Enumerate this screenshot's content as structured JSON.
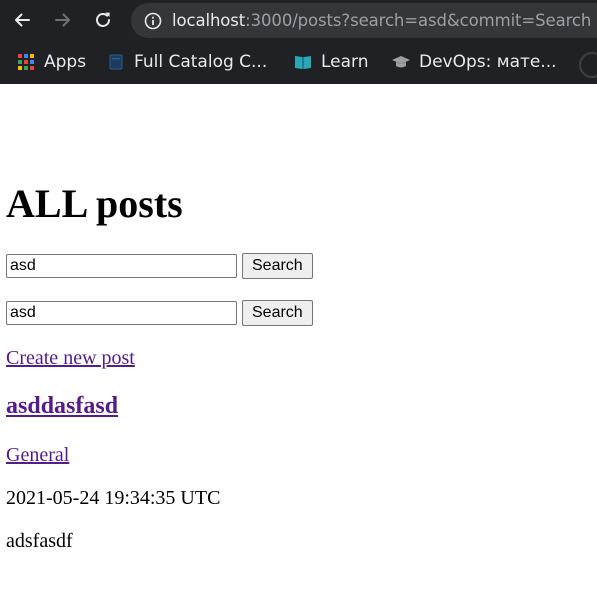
{
  "browser": {
    "url_host": "localhost",
    "url_rest": ":3000/posts?search=asd&commit=Search",
    "bookmarks": [
      {
        "label": "Apps",
        "icon": "apps-grid-icon"
      },
      {
        "label": "Full Catalog C...",
        "icon": "catalog-icon"
      },
      {
        "label": "Learn",
        "icon": "book-icon"
      },
      {
        "label": "DevOps: мате...",
        "icon": "graduation-cap-icon"
      }
    ]
  },
  "page": {
    "title": "ALL posts",
    "search_forms": [
      {
        "value": "asd",
        "button": "Search"
      },
      {
        "value": "asd",
        "button": "Search"
      }
    ],
    "create_link": "Create new post",
    "post": {
      "title": "asddasfasd",
      "category": "General",
      "timestamp": "2021-05-24 19:34:35 UTC",
      "body": "adsfasdf"
    }
  },
  "colors": {
    "chrome_bg": "#202124",
    "omnibox_bg": "#35363a",
    "visited_link": "#551a8b"
  }
}
